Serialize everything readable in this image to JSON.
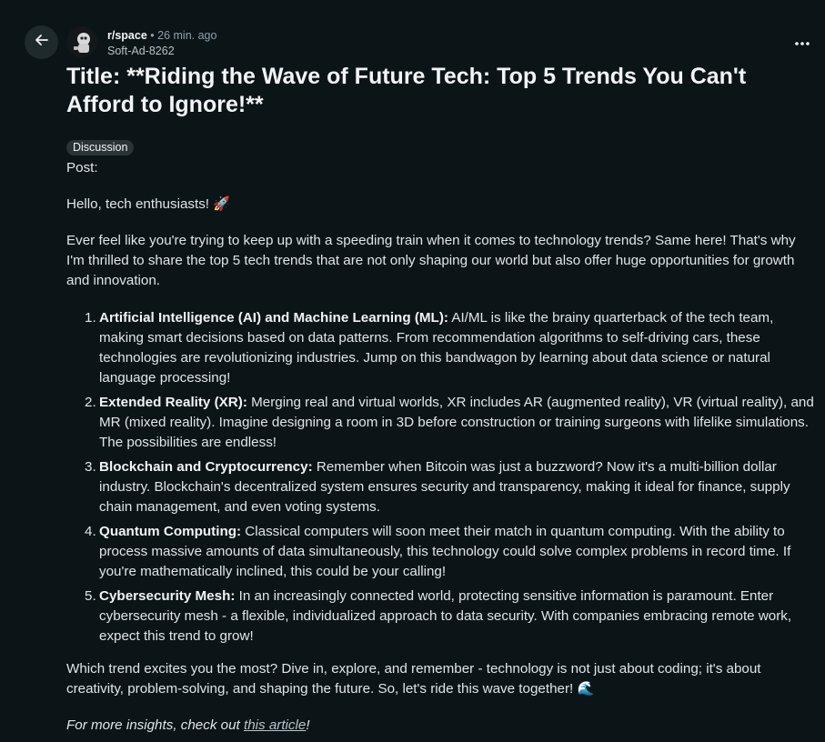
{
  "header": {
    "subreddit": "r/space",
    "separator": "•",
    "time": "26 min. ago",
    "author": "Soft-Ad-8262"
  },
  "post": {
    "title": "Title: **Riding the Wave of Future Tech: Top 5 Trends You Can't Afford to Ignore!**",
    "flair": "Discussion",
    "post_label": "Post:",
    "greeting": "Hello, tech enthusiasts! 🚀",
    "intro": "Ever feel like you're trying to keep up with a speeding train when it comes to technology trends? Same here! That's why I'm thrilled to share the top 5 tech trends that are not only shaping our world but also offer huge opportunities for growth and innovation.",
    "trends": [
      {
        "number": "1.",
        "heading": "Artificial Intelligence (AI) and Machine Learning (ML):",
        "text": " AI/ML is like the brainy quarterback of the tech team, making smart decisions based on data patterns. From recommendation algorithms to self-driving cars, these technologies are revolutionizing industries. Jump on this bandwagon by learning about data science or natural language processing!"
      },
      {
        "number": "2.",
        "heading": "Extended Reality (XR):",
        "text": " Merging real and virtual worlds, XR includes AR (augmented reality), VR (virtual reality), and MR (mixed reality). Imagine designing a room in 3D before construction or training surgeons with lifelike simulations. The possibilities are endless!"
      },
      {
        "number": "3.",
        "heading": "Blockchain and Cryptocurrency:",
        "text": " Remember when Bitcoin was just a buzzword? Now it's a multi-billion dollar industry. Blockchain's decentralized system ensures security and transparency, making it ideal for finance, supply chain management, and even voting systems."
      },
      {
        "number": "4.",
        "heading": "Quantum Computing:",
        "text": " Classical computers will soon meet their match in quantum computing. With the ability to process massive amounts of data simultaneously, this technology could solve complex problems in record time. If you're mathematically inclined, this could be your calling!"
      },
      {
        "number": "5.",
        "heading": "Cybersecurity Mesh:",
        "text": " In an increasingly connected world, protecting sensitive information is paramount. Enter cybersecurity mesh - a flexible, individualized approach to data security. With companies embracing remote work, expect this trend to grow!"
      }
    ],
    "outro": "Which trend excites you the most? Dive in, explore, and remember - technology is not just about coding; it's about creativity, problem-solving, and shaping the future. So, let's ride this wave together! 🌊",
    "more_prefix": "For more insights, check out ",
    "more_link": "this article",
    "more_suffix": "!"
  },
  "icons": {
    "back": "arrow-left-icon",
    "more": "more-horizontal-icon",
    "avatar": "subreddit-avatar"
  },
  "colors": {
    "background": "#0b1416",
    "text": "#f2f4f5",
    "muted": "#8ba2ad",
    "flair_bg": "#2a3336",
    "back_button_bg": "#1e2a2c"
  }
}
